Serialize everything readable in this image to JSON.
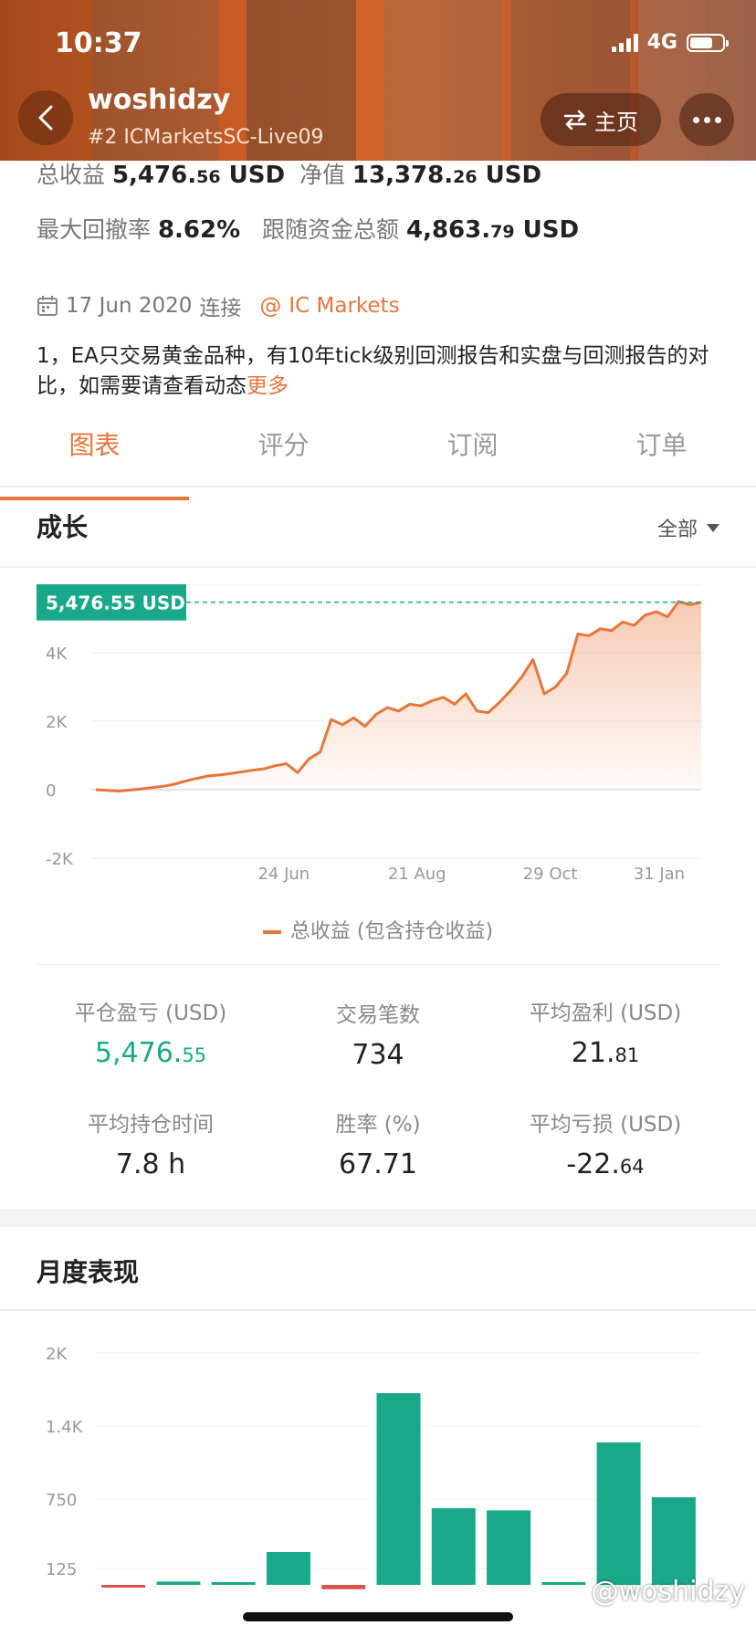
{
  "status": {
    "time": "10:37",
    "network": "4G"
  },
  "header": {
    "name": "woshidzy",
    "account": "#2 ICMarketsSC-Live09",
    "home_label": "主页"
  },
  "summary": {
    "total_label": "总收益",
    "total_int": "5,476.",
    "total_dec": "56",
    "total_unit": "USD",
    "equity_label": "净值",
    "equity_int": "13,378.",
    "equity_dec": "26",
    "equity_unit": "USD",
    "drawdown_label": "最大回撤率",
    "drawdown_value": "8.62%",
    "follow_label": "跟随资金总额",
    "follow_int": "4,863.",
    "follow_dec": "79",
    "follow_unit": "USD"
  },
  "info": {
    "date": "17 Jun 2020",
    "connect": "连接",
    "at": "@",
    "broker": "IC Markets"
  },
  "description": {
    "text": "1，EA只交易黄金品种，有10年tick级别回测报告和实盘与回测报告的对比，如需要请查看动态",
    "more": "更多"
  },
  "tabs": [
    "图表",
    "评分",
    "订阅",
    "订单"
  ],
  "growth": {
    "title": "成长",
    "filter": "全部",
    "legend": "总收益 (包含持仓收益)"
  },
  "stats": {
    "closed_pl_label": "平仓盈亏 (USD)",
    "closed_pl_int": "5,476.",
    "closed_pl_dec": "55",
    "trades_label": "交易笔数",
    "trades_value": "734",
    "avg_profit_label": "平均盈利 (USD)",
    "avg_profit_int": "21.",
    "avg_profit_dec": "81",
    "hold_label": "平均持仓时间",
    "hold_value": "7.8 h",
    "winrate_label": "胜率 (%)",
    "winrate_value": "67.71",
    "avg_loss_label": "平均亏损 (USD)",
    "avg_loss_int": "-22.",
    "avg_loss_dec": "64"
  },
  "monthly": {
    "title": "月度表现"
  },
  "watermark": "@woshidzy",
  "colors": {
    "accent": "#e8753a",
    "green": "#19a98a",
    "red": "#d9534f"
  },
  "chart_data": [
    {
      "type": "area",
      "title": "成长",
      "ylim": [
        -2000,
        6000
      ],
      "yticks": [
        "-2K",
        "0",
        "2K",
        "4K"
      ],
      "x_tick_labels": [
        "24 Jun",
        "21 Aug",
        "29 Oct",
        "31 Jan"
      ],
      "current_label": "5,476.55 USD",
      "current_value": 5476.55,
      "series": [
        {
          "name": "总收益 (包含持仓收益)",
          "values": [
            0,
            -20,
            -40,
            -10,
            20,
            60,
            100,
            160,
            250,
            330,
            400,
            430,
            470,
            520,
            570,
            610,
            700,
            760,
            500,
            900,
            1100,
            2050,
            1900,
            2100,
            1850,
            2200,
            2400,
            2300,
            2500,
            2450,
            2600,
            2700,
            2500,
            2800,
            2300,
            2250,
            2550,
            2900,
            3300,
            3800,
            2800,
            3000,
            3400,
            4550,
            4500,
            4700,
            4650,
            4900,
            4800,
            5100,
            5200,
            5050,
            5500,
            5400,
            5476.55
          ]
        }
      ]
    },
    {
      "type": "bar",
      "title": "月度表现",
      "yticks": [
        "125",
        "750",
        "1.4K",
        "2K"
      ],
      "values": [
        -10,
        30,
        25,
        300,
        -40,
        1750,
        700,
        680,
        5,
        1300,
        800
      ],
      "value_colors": [
        "#d9534f",
        "#19a98a",
        "#19a98a",
        "#19a98a",
        "#d9534f",
        "#19a98a",
        "#19a98a",
        "#19a98a",
        "#19a98a",
        "#19a98a",
        "#19a98a"
      ]
    }
  ]
}
